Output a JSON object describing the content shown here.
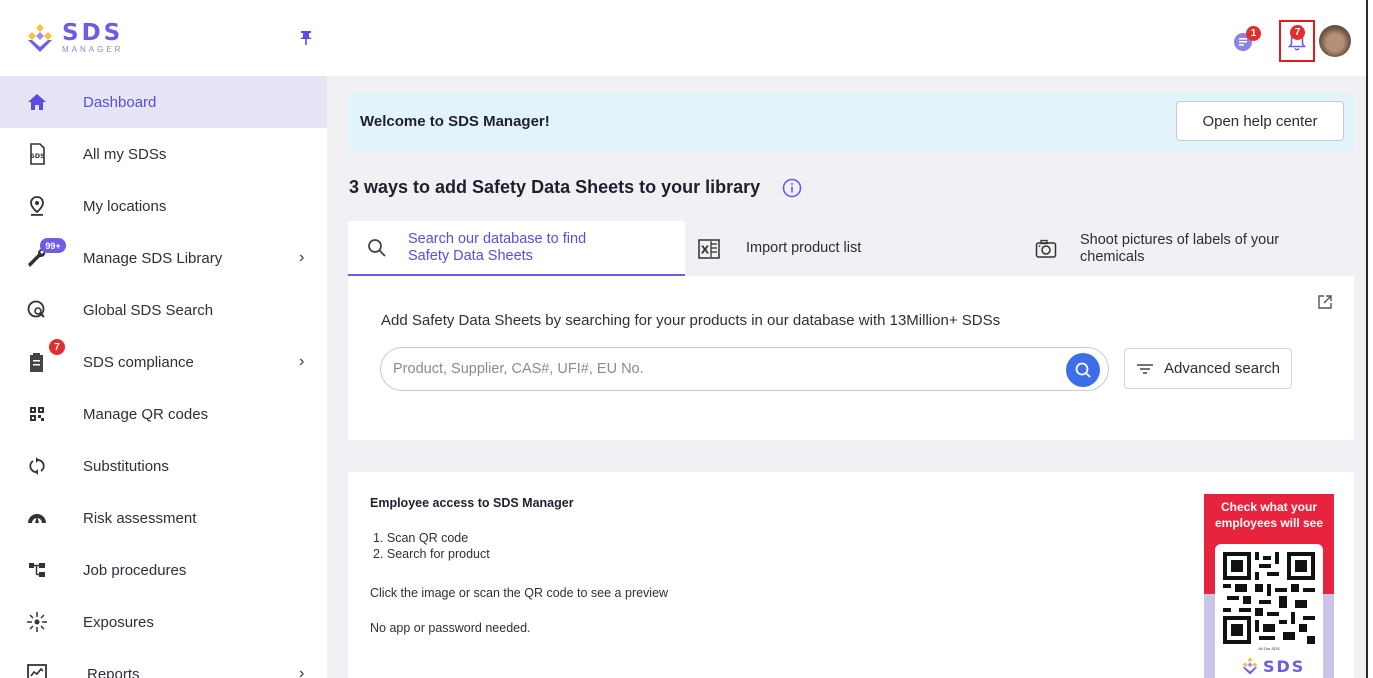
{
  "brand": {
    "name": "SDS",
    "sub": "MANAGER"
  },
  "header": {
    "chat_badge": "1",
    "notification_badge": "7"
  },
  "sidebar": {
    "items": [
      {
        "label": "Dashboard",
        "icon": "home-icon",
        "active": true
      },
      {
        "label": "All my SDSs",
        "icon": "sds-document-icon"
      },
      {
        "label": "My locations",
        "icon": "location-pin-icon"
      },
      {
        "label": "Manage SDS Library",
        "icon": "wrench-icon",
        "badge": "99+",
        "chevron": true
      },
      {
        "label": "Global SDS Search",
        "icon": "global-search-icon"
      },
      {
        "label": "SDS compliance",
        "icon": "clipboard-icon",
        "badge": "7",
        "chevron": true
      },
      {
        "label": "Manage QR codes",
        "icon": "qr-code-icon"
      },
      {
        "label": "Substitutions",
        "icon": "swap-icon"
      },
      {
        "label": "Risk assessment",
        "icon": "gauge-icon"
      },
      {
        "label": "Job procedures",
        "icon": "hierarchy-icon"
      },
      {
        "label": "Exposures",
        "icon": "exposure-icon"
      },
      {
        "label": "Reports",
        "icon": "report-chart-icon",
        "chevron": true
      }
    ],
    "chevron_glyph": "›"
  },
  "main": {
    "welcome": "Welcome to SDS Manager!",
    "help_button": "Open help center",
    "ways_title": "3 ways to add Safety Data Sheets to your library",
    "tabs": [
      {
        "label_line1": "Search our database to find",
        "label_line2": "Safety Data Sheets",
        "icon": "search-icon"
      },
      {
        "label_line1": "Import product list",
        "label_line2": "",
        "icon": "excel-icon"
      },
      {
        "label_line1": "Shoot pictures of labels of your",
        "label_line2": "chemicals",
        "icon": "camera-icon"
      }
    ],
    "search": {
      "description": "Add Safety Data Sheets by searching for your products in our database with 13Million+ SDSs",
      "placeholder": "Product, Supplier, CAS#, UFI#, EU No.",
      "value": "",
      "advanced_label": "Advanced search"
    },
    "employee": {
      "title": "Employee access to SDS Manager",
      "steps": [
        "1. Scan QR code",
        "2. Search for product"
      ],
      "click_text": "Click the image or scan the QR code to see a preview",
      "no_app_text": "No app or password needed.",
      "promo_line1": "Check what your",
      "promo_line2": "employees will see",
      "qr_caption": "All Our SDS",
      "promo_brand": "SDS"
    }
  },
  "colors": {
    "accent": "#6c5ce7",
    "active_bg": "#e6e5f6",
    "badge": "#e02f2f",
    "search_btn": "#3d6ee8",
    "promo_red": "#e8233d"
  }
}
